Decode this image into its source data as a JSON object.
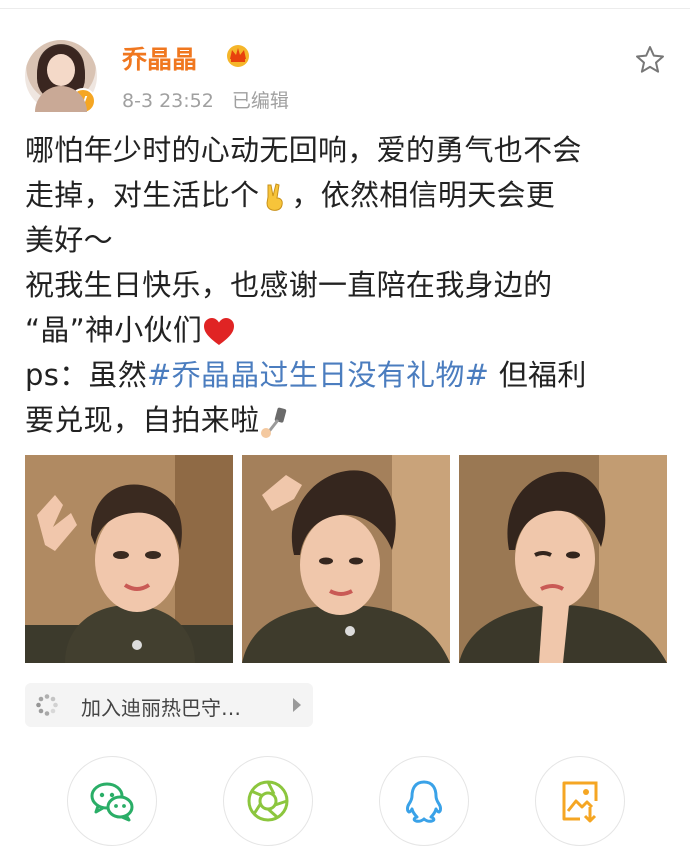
{
  "post": {
    "username": "乔晶晶",
    "time": "8-3 23:52",
    "edited": "已编辑",
    "verified_badge": "V",
    "lines": [
      {
        "pre": "哪怕年少时的心动无回响，爱的勇气也不会"
      },
      {
        "pre": "走掉，对生活比个",
        "emoji": "victory-hand",
        "post": "，依然相信明天会更"
      },
      {
        "pre": "美好～"
      },
      {
        "pre": "祝我生日快乐，也感谢一直陪在我身边的"
      },
      {
        "pre": "“晶”神小伙们",
        "emoji": "red-heart"
      },
      {
        "pre": "ps：虽然",
        "hashtag": "#乔晶晶过生日没有礼物#",
        "post": " 但福利"
      },
      {
        "pre": "要兑现，自拍来啦",
        "emoji": "selfie-stick"
      }
    ]
  },
  "photos": [
    {
      "name": "selfie-peace-sign"
    },
    {
      "name": "selfie-hand-in-hair"
    },
    {
      "name": "selfie-wink"
    }
  ],
  "chip": {
    "label": "加入迪丽热巴守…",
    "icon": "loading-spinner-icon"
  },
  "share": [
    {
      "name": "wechat",
      "color": "#2aae67"
    },
    {
      "name": "moments",
      "color": "#8cc63e"
    },
    {
      "name": "qq",
      "color": "#3aa2e8"
    },
    {
      "name": "save-image",
      "color": "#f5a623"
    }
  ],
  "colors": {
    "username": "#f0771f",
    "hashtag": "#4b7dbf",
    "meta": "#a0a0a0"
  }
}
